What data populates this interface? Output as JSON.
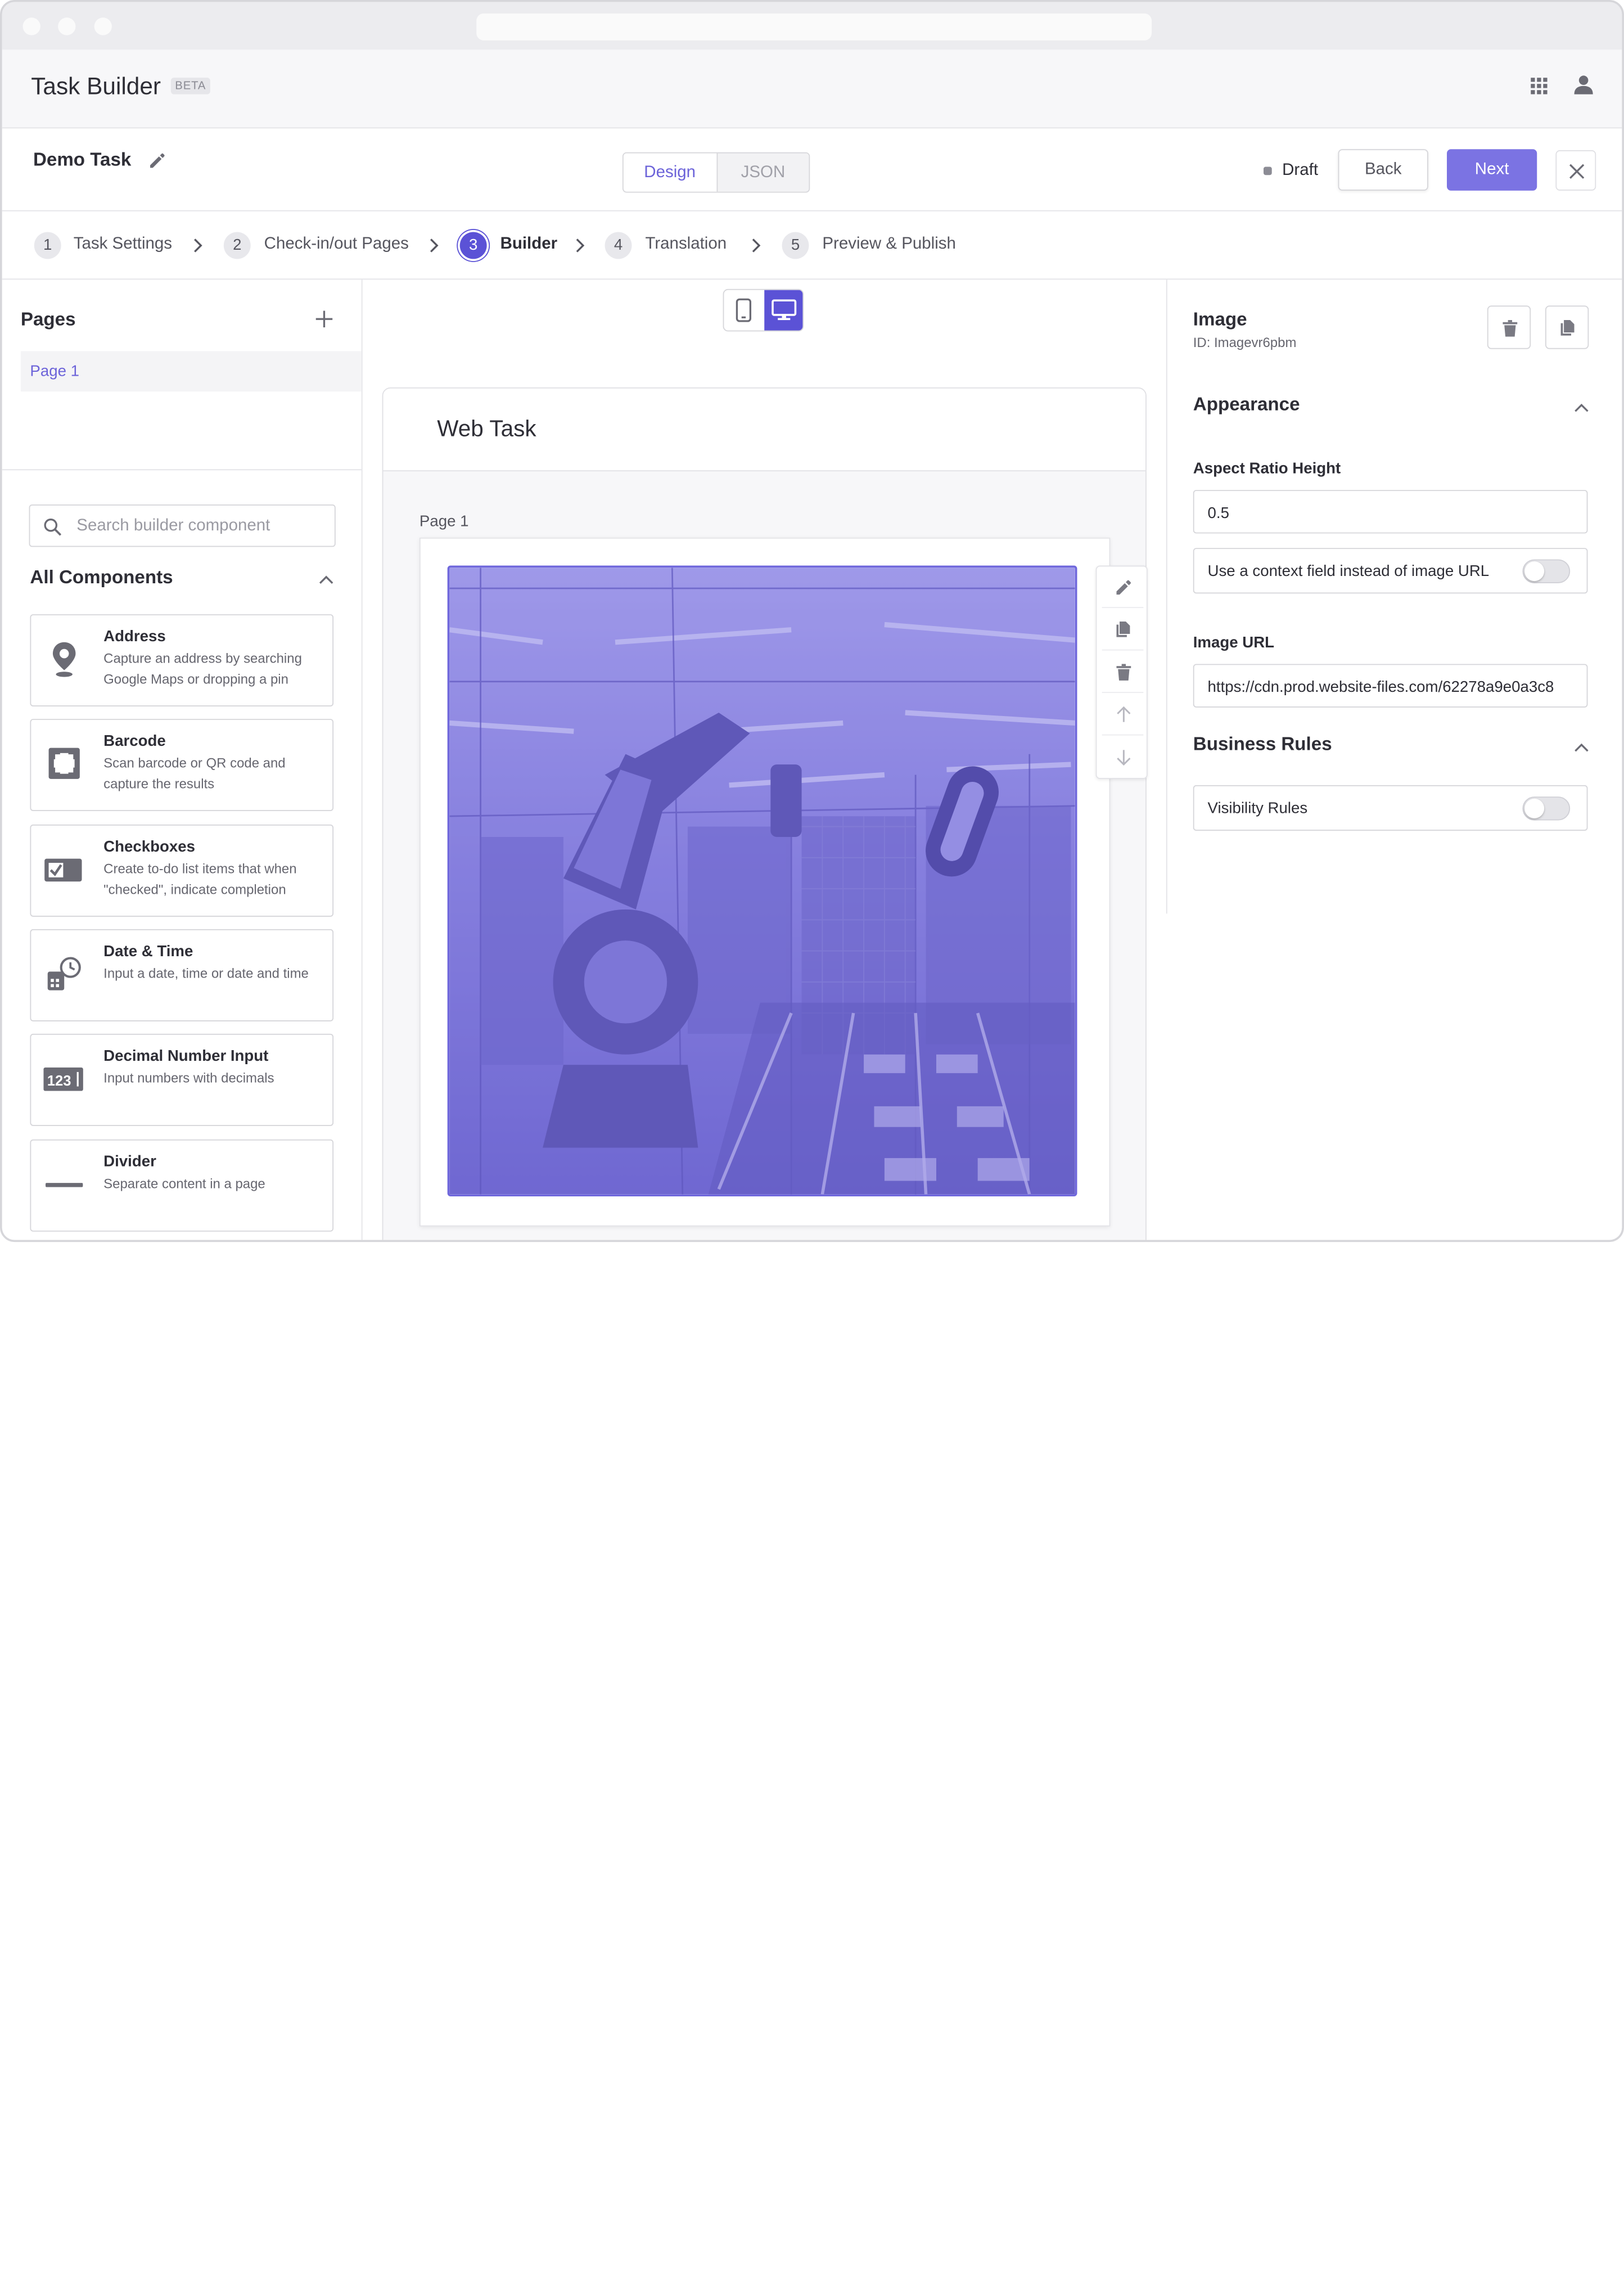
{
  "app": {
    "title": "Task Builder",
    "badge": "BETA"
  },
  "task": {
    "name": "Demo Task",
    "view_tabs": [
      "Design",
      "JSON"
    ],
    "status": "Draft",
    "back_label": "Back",
    "next_label": "Next"
  },
  "steps": [
    {
      "num": "1",
      "label": "Task Settings"
    },
    {
      "num": "2",
      "label": "Check-in/out Pages"
    },
    {
      "num": "3",
      "label": "Builder"
    },
    {
      "num": "4",
      "label": "Translation"
    },
    {
      "num": "5",
      "label": "Preview & Publish"
    }
  ],
  "active_step": 3,
  "pages_panel": {
    "title": "Pages",
    "items": [
      "Page 1"
    ],
    "search_placeholder": "Search builder component",
    "components_title": "All Components",
    "components": [
      {
        "name": "Address",
        "desc": "Capture an address by searching Google Maps or dropping a pin",
        "icon": "map-pin-icon"
      },
      {
        "name": "Barcode",
        "desc": "Scan barcode or QR code and capture the results",
        "icon": "barcode-scan-icon"
      },
      {
        "name": "Checkboxes",
        "desc": "Create to-do list items that when \"checked\", indicate completion",
        "icon": "checkbox-icon"
      },
      {
        "name": "Date & Time",
        "desc": "Input a date, time or date and time",
        "icon": "calendar-clock-icon"
      },
      {
        "name": "Decimal Number Input",
        "desc": "Input numbers with decimals",
        "icon": "number-input-icon"
      },
      {
        "name": "Divider",
        "desc": "Separate content in a page",
        "icon": "divider-icon"
      }
    ]
  },
  "canvas": {
    "title": "Web Task",
    "page_label": "Page 1",
    "device_mode": "desktop"
  },
  "properties": {
    "title": "Image",
    "id_text": "ID: Imagevr6pbm",
    "appearance_title": "Appearance",
    "aspect_label": "Aspect Ratio Height",
    "aspect_value": "0.5",
    "context_toggle_label": "Use a context field instead of image URL",
    "context_toggle_on": false,
    "url_label": "Image URL",
    "url_value": "https://cdn.prod.website-files.com/62278a9e0a3c8",
    "rules_title": "Business Rules",
    "visibility_label": "Visibility Rules",
    "visibility_on": false
  },
  "colors": {
    "accent": "#5b52d6",
    "button": "#7b73e3",
    "image_tint": "#7a72dd"
  }
}
